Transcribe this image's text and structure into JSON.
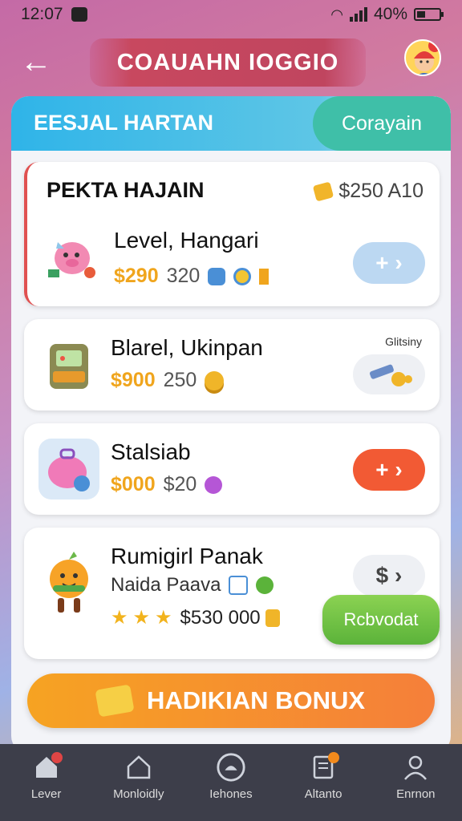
{
  "status": {
    "time": "12:07",
    "battery": "40%"
  },
  "appbar": {
    "title": "COAUAHN IOGGIO"
  },
  "panel": {
    "header_label": "EESJAL HARTAN",
    "tab_label": "Corayain"
  },
  "cards": [
    {
      "title": "PEKTA HAJAIN",
      "price": "$250 A10",
      "name": "Level, Hangari",
      "gold": "$290",
      "gray": "320",
      "action_label": "+ ›",
      "action_color": "#bcd8f2"
    },
    {
      "name": "Blarel, Ukinpan",
      "gold": "$900",
      "gray": "250",
      "top_label": "Glitsiny"
    },
    {
      "name": "Stalsiab",
      "gold": "$000",
      "gray": "$20",
      "action_label": "+ ›",
      "action_color": "#f25a34"
    },
    {
      "name": "Rumigirl Panak",
      "sub": "Naida Paava",
      "price": "$530 000",
      "action_label": "$ ›"
    }
  ],
  "bonus": {
    "label": "HADIKIAN BONUX"
  },
  "green_button": {
    "label": "Rcbvodat"
  },
  "nav": [
    {
      "label": "Lever",
      "icon": "home-icon"
    },
    {
      "label": "Monloidly",
      "icon": "house-outline-icon"
    },
    {
      "label": "Iehones",
      "icon": "circle-icon"
    },
    {
      "label": "Altanto",
      "icon": "clipboard-icon"
    },
    {
      "label": "Enrnon",
      "icon": "person-icon"
    }
  ],
  "colors": {
    "accent_blue": "#2fb4e8",
    "accent_teal": "#3fbfa8",
    "gold": "#f0a51d",
    "orange": "#f57f3a",
    "green": "#5bb33a"
  }
}
